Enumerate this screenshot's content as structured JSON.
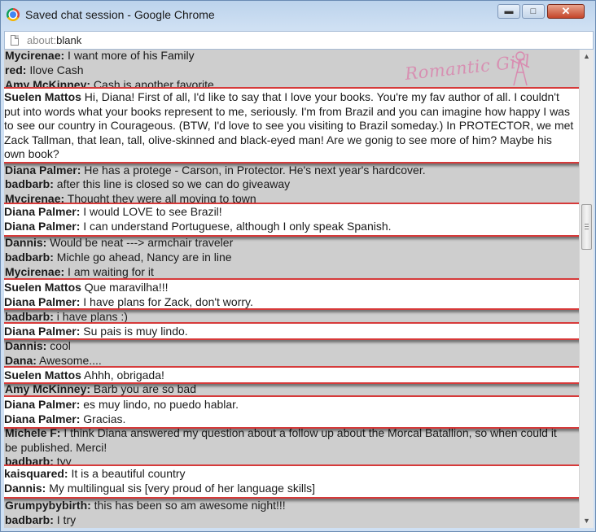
{
  "window": {
    "title": "Saved chat session - Google Chrome",
    "minimize_glyph": "▬",
    "maximize_glyph": "□",
    "close_glyph": "✕"
  },
  "address": {
    "protocol": "about:",
    "path": "blank"
  },
  "watermark_text": "Romantic Girl",
  "chat_lines": [
    {
      "name": "Mycirenae:",
      "text": " I want more of his Family"
    },
    {
      "name": "red:",
      "text": " Ilove Cash"
    },
    {
      "name": "Amy McKinney:",
      "text": " Cash is another favorite"
    },
    {
      "name": "Diana Palmer:",
      "text": " He has a protege - Carson, in Protector. He's next year's hardcover."
    },
    {
      "name": "badbarb:",
      "text": " after this line is closed so we can do giveaway"
    },
    {
      "name": "Mycirenae:",
      "text": " Thought they were all moving to town"
    },
    {
      "name": "Dannis:",
      "text": " Would be neat ---> armchair traveler"
    },
    {
      "name": "badbarb:",
      "text": " Michle go ahead, Nancy are in line"
    },
    {
      "name": "Mycirenae:",
      "text": " I am waiting for it"
    },
    {
      "name": "badbarb:",
      "text": " i have plans :)"
    },
    {
      "name": "Dannis:",
      "text": " cool"
    },
    {
      "name": "Dana:",
      "text": " Awesome...."
    },
    {
      "name": "Amy McKinney:",
      "text": " Barb you are so bad"
    },
    {
      "name": "Michele F:",
      "text": " I think Diana answered my question about a follow up about the Morcal Batallion, so when could it"
    },
    {
      "name": "",
      "text": "be published. Merci!"
    },
    {
      "name": "badbarb:",
      "text": " tyy"
    },
    {
      "name": "Grumpybybirth:",
      "text": " this has been so am awesome night!!!"
    },
    {
      "name": "badbarb:",
      "text": " I try"
    }
  ],
  "highlights": [
    {
      "name": "Suelen Mattos",
      "text": " Hi, Diana! First of all, I'd like to say that I love your books. You're my fav author of all. I couldn't put into words what your books represent to me, seriously. I'm from Brazil and you can imagine how happy I was to see our country in Courageous. (BTW, I'd love to see you visiting to Brazil someday.) In PROTECTOR, we met Zack Tallman, that lean, tall, olive-skinned and black-eyed man! Are we gonig to see more of him? Maybe his own book?"
    },
    {
      "lines": [
        {
          "name": "Diana Palmer:",
          "text": " I would LOVE to see Brazil!"
        },
        {
          "name": "Diana Palmer:",
          "text": " I can understand Portuguese, although I only speak Spanish."
        }
      ]
    },
    {
      "lines": [
        {
          "name": "Suelen Mattos",
          "text": " Que maravilha!!!"
        },
        {
          "name": "Diana Palmer:",
          "text": " I have plans for Zack, don't worry."
        }
      ]
    },
    {
      "lines": [
        {
          "name": "Diana Palmer:",
          "text": " Su pais is muy lindo."
        }
      ]
    },
    {
      "lines": [
        {
          "name": "Suelen Mattos",
          "text": " Ahhh, obrigada!"
        }
      ]
    },
    {
      "lines": [
        {
          "name": "Diana Palmer:",
          "text": " es muy lindo, no puedo hablar."
        },
        {
          "name": "Diana Palmer:",
          "text": " Gracias."
        }
      ]
    },
    {
      "lines": [
        {
          "name": "kaisquared:",
          "text": " It is a beautiful country"
        },
        {
          "name": "Dannis:",
          "text": " My multilingual sis [very proud of her language skills]"
        }
      ]
    }
  ],
  "scrollbar": {
    "up_glyph": "▲",
    "down_glyph": "▼"
  }
}
